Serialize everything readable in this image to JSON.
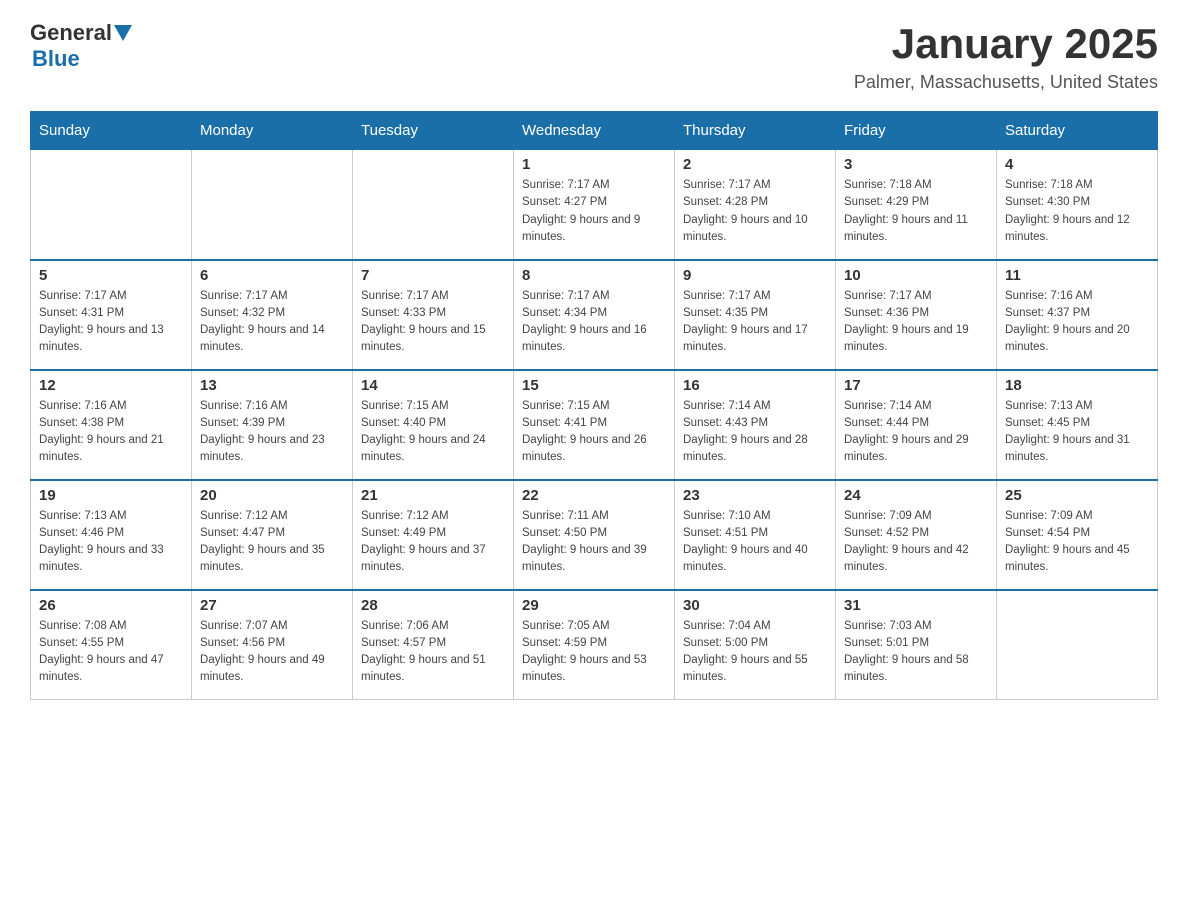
{
  "header": {
    "logo_general": "General",
    "logo_blue": "Blue",
    "month": "January 2025",
    "location": "Palmer, Massachusetts, United States"
  },
  "days_of_week": [
    "Sunday",
    "Monday",
    "Tuesday",
    "Wednesday",
    "Thursday",
    "Friday",
    "Saturday"
  ],
  "weeks": [
    [
      {
        "day": "",
        "info": ""
      },
      {
        "day": "",
        "info": ""
      },
      {
        "day": "",
        "info": ""
      },
      {
        "day": "1",
        "info": "Sunrise: 7:17 AM\nSunset: 4:27 PM\nDaylight: 9 hours and 9 minutes."
      },
      {
        "day": "2",
        "info": "Sunrise: 7:17 AM\nSunset: 4:28 PM\nDaylight: 9 hours and 10 minutes."
      },
      {
        "day": "3",
        "info": "Sunrise: 7:18 AM\nSunset: 4:29 PM\nDaylight: 9 hours and 11 minutes."
      },
      {
        "day": "4",
        "info": "Sunrise: 7:18 AM\nSunset: 4:30 PM\nDaylight: 9 hours and 12 minutes."
      }
    ],
    [
      {
        "day": "5",
        "info": "Sunrise: 7:17 AM\nSunset: 4:31 PM\nDaylight: 9 hours and 13 minutes."
      },
      {
        "day": "6",
        "info": "Sunrise: 7:17 AM\nSunset: 4:32 PM\nDaylight: 9 hours and 14 minutes."
      },
      {
        "day": "7",
        "info": "Sunrise: 7:17 AM\nSunset: 4:33 PM\nDaylight: 9 hours and 15 minutes."
      },
      {
        "day": "8",
        "info": "Sunrise: 7:17 AM\nSunset: 4:34 PM\nDaylight: 9 hours and 16 minutes."
      },
      {
        "day": "9",
        "info": "Sunrise: 7:17 AM\nSunset: 4:35 PM\nDaylight: 9 hours and 17 minutes."
      },
      {
        "day": "10",
        "info": "Sunrise: 7:17 AM\nSunset: 4:36 PM\nDaylight: 9 hours and 19 minutes."
      },
      {
        "day": "11",
        "info": "Sunrise: 7:16 AM\nSunset: 4:37 PM\nDaylight: 9 hours and 20 minutes."
      }
    ],
    [
      {
        "day": "12",
        "info": "Sunrise: 7:16 AM\nSunset: 4:38 PM\nDaylight: 9 hours and 21 minutes."
      },
      {
        "day": "13",
        "info": "Sunrise: 7:16 AM\nSunset: 4:39 PM\nDaylight: 9 hours and 23 minutes."
      },
      {
        "day": "14",
        "info": "Sunrise: 7:15 AM\nSunset: 4:40 PM\nDaylight: 9 hours and 24 minutes."
      },
      {
        "day": "15",
        "info": "Sunrise: 7:15 AM\nSunset: 4:41 PM\nDaylight: 9 hours and 26 minutes."
      },
      {
        "day": "16",
        "info": "Sunrise: 7:14 AM\nSunset: 4:43 PM\nDaylight: 9 hours and 28 minutes."
      },
      {
        "day": "17",
        "info": "Sunrise: 7:14 AM\nSunset: 4:44 PM\nDaylight: 9 hours and 29 minutes."
      },
      {
        "day": "18",
        "info": "Sunrise: 7:13 AM\nSunset: 4:45 PM\nDaylight: 9 hours and 31 minutes."
      }
    ],
    [
      {
        "day": "19",
        "info": "Sunrise: 7:13 AM\nSunset: 4:46 PM\nDaylight: 9 hours and 33 minutes."
      },
      {
        "day": "20",
        "info": "Sunrise: 7:12 AM\nSunset: 4:47 PM\nDaylight: 9 hours and 35 minutes."
      },
      {
        "day": "21",
        "info": "Sunrise: 7:12 AM\nSunset: 4:49 PM\nDaylight: 9 hours and 37 minutes."
      },
      {
        "day": "22",
        "info": "Sunrise: 7:11 AM\nSunset: 4:50 PM\nDaylight: 9 hours and 39 minutes."
      },
      {
        "day": "23",
        "info": "Sunrise: 7:10 AM\nSunset: 4:51 PM\nDaylight: 9 hours and 40 minutes."
      },
      {
        "day": "24",
        "info": "Sunrise: 7:09 AM\nSunset: 4:52 PM\nDaylight: 9 hours and 42 minutes."
      },
      {
        "day": "25",
        "info": "Sunrise: 7:09 AM\nSunset: 4:54 PM\nDaylight: 9 hours and 45 minutes."
      }
    ],
    [
      {
        "day": "26",
        "info": "Sunrise: 7:08 AM\nSunset: 4:55 PM\nDaylight: 9 hours and 47 minutes."
      },
      {
        "day": "27",
        "info": "Sunrise: 7:07 AM\nSunset: 4:56 PM\nDaylight: 9 hours and 49 minutes."
      },
      {
        "day": "28",
        "info": "Sunrise: 7:06 AM\nSunset: 4:57 PM\nDaylight: 9 hours and 51 minutes."
      },
      {
        "day": "29",
        "info": "Sunrise: 7:05 AM\nSunset: 4:59 PM\nDaylight: 9 hours and 53 minutes."
      },
      {
        "day": "30",
        "info": "Sunrise: 7:04 AM\nSunset: 5:00 PM\nDaylight: 9 hours and 55 minutes."
      },
      {
        "day": "31",
        "info": "Sunrise: 7:03 AM\nSunset: 5:01 PM\nDaylight: 9 hours and 58 minutes."
      },
      {
        "day": "",
        "info": ""
      }
    ]
  ]
}
